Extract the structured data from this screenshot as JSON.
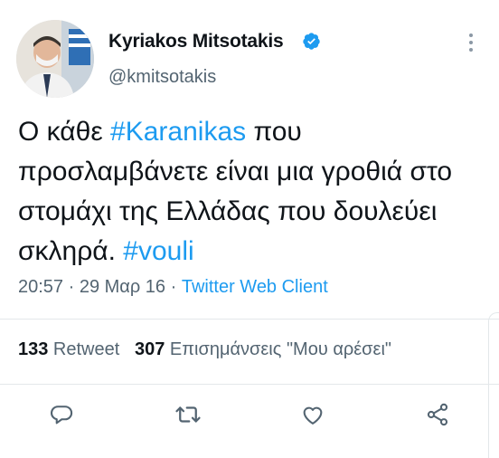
{
  "tweet": {
    "author_name": "Kyriakos Mitsotakis",
    "handle": "@kmitsotakis",
    "text_1": "Ο κάθε ",
    "hashtag_1": "#Karanikas",
    "text_2": " που προσλαμβάνετε είναι μια γροθιά στο στομάχι της Ελλάδας που δουλεύει σκληρά. ",
    "hashtag_2": "#vouli",
    "time": "20:57",
    "sep_1": " · ",
    "date": "29 Μαρ 16",
    "sep_2": " · ",
    "source": "Twitter Web Client"
  },
  "stats": {
    "retweets_count": "133",
    "retweets_label": " Retweet",
    "likes_count": "307",
    "likes_label": " Επισημάνσεις \"Μου αρέσει\""
  },
  "icons": {
    "reply": "reply-icon",
    "retweet": "retweet-icon",
    "like": "heart-icon",
    "share": "share-icon",
    "verified": "verified-badge-icon",
    "more": "more-vertical-icon"
  },
  "colors": {
    "accent": "#1d9bf0",
    "text": "#0f1419",
    "secondary": "#536471"
  }
}
